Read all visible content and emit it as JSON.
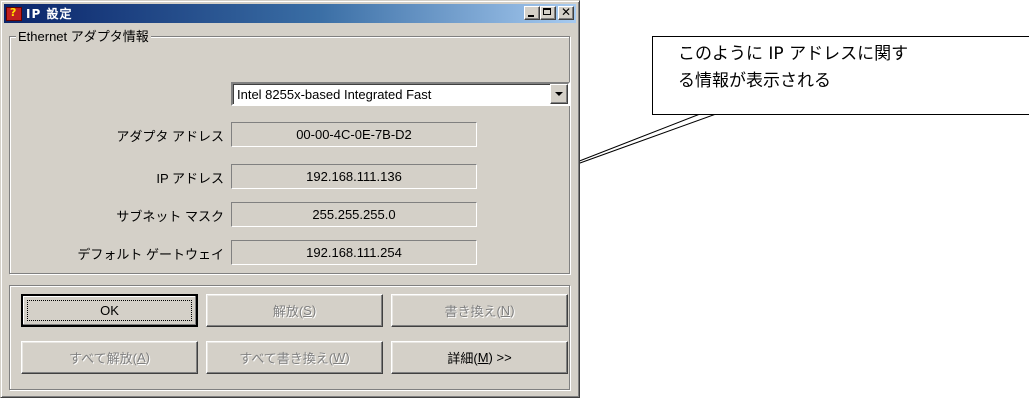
{
  "window": {
    "title": "IP 設定"
  },
  "adapter_group": {
    "legend": "Ethernet  アダプタ情報",
    "adapter_select": "Intel 8255x-based Integrated Fast",
    "rows": [
      {
        "label": "アダプタ アドレス",
        "value": "00-00-4C-0E-7B-D2"
      },
      {
        "label": "IP アドレス",
        "value": "192.168.111.136"
      },
      {
        "label": "サブネット マスク",
        "value": "255.255.255.0"
      },
      {
        "label": "デフォルト ゲートウェイ",
        "value": "192.168.111.254"
      }
    ]
  },
  "buttons": {
    "ok": "OK",
    "release": {
      "text": "解放(",
      "key": "S",
      "end": ")"
    },
    "renew": {
      "text": "書き換え(",
      "key": "N",
      "end": ")"
    },
    "release_all": {
      "text": "すべて解放(",
      "key": "A",
      "end": ")"
    },
    "renew_all": {
      "text": "すべて書き換え(",
      "key": "W",
      "end": ")"
    },
    "details": {
      "text": "詳細(",
      "key": "M",
      "end": ") >>"
    }
  },
  "callout": {
    "line1": "このように IP アドレスに関す",
    "line2": "る情報が表示される"
  }
}
